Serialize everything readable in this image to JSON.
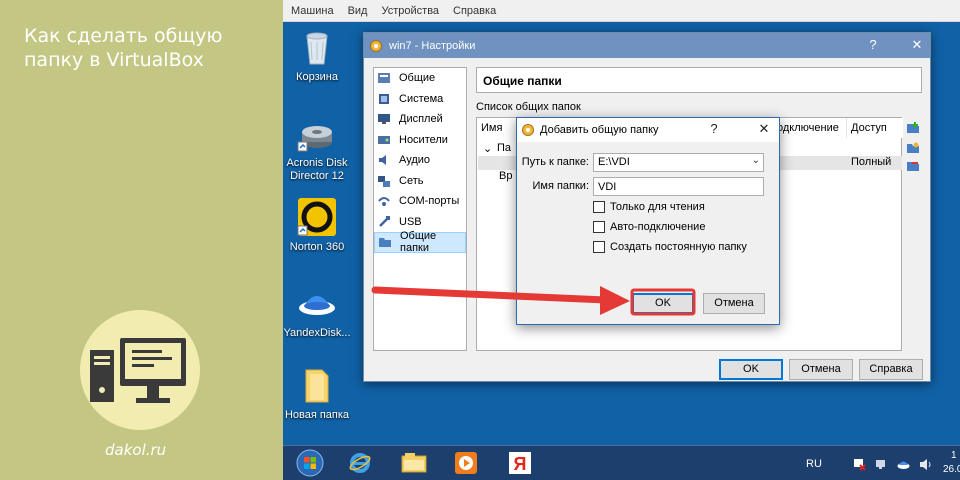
{
  "promo": {
    "title": "Как сделать общую папку в VirtualBox",
    "site": "dakol.ru"
  },
  "host_menu": [
    "Машина",
    "Вид",
    "Устройства",
    "Справка"
  ],
  "desktop_icons": [
    {
      "label": "Корзина",
      "icon": "recycle-bin-icon"
    },
    {
      "label": "Acronis Disk Director 12",
      "icon": "acronis-disk-icon"
    },
    {
      "label": "Norton 360",
      "icon": "norton-icon"
    },
    {
      "label": "YandexDisk...",
      "icon": "yandex-disk-icon"
    },
    {
      "label": "Новая папка",
      "icon": "folder-icon"
    }
  ],
  "settings": {
    "title": "win7 - Настройки",
    "help_btn": "?",
    "close_btn": "✕",
    "nav": [
      {
        "label": "Общие",
        "icon": "general-icon"
      },
      {
        "label": "Система",
        "icon": "system-icon"
      },
      {
        "label": "Дисплей",
        "icon": "display-icon"
      },
      {
        "label": "Носители",
        "icon": "storage-icon"
      },
      {
        "label": "Аудио",
        "icon": "audio-icon"
      },
      {
        "label": "Сеть",
        "icon": "network-icon"
      },
      {
        "label": "COM-порты",
        "icon": "com-ports-icon"
      },
      {
        "label": "USB",
        "icon": "usb-icon"
      },
      {
        "label": "Общие папки",
        "icon": "shared-folders-icon"
      }
    ],
    "active_nav": "Общие папки",
    "section_title": "Общие папки",
    "folders_label": "Список общих папок",
    "table": {
      "col_name": "Имя",
      "col_auto": "одключение",
      "col_access": "Доступ",
      "row_group_partial": "Па",
      "row_item_partial": "Вр",
      "row_access": "Полный"
    },
    "buttons": {
      "ok": "OK",
      "cancel": "Отмена",
      "help": "Справка"
    }
  },
  "dialog": {
    "title": "Добавить общую папку",
    "help_btn": "?",
    "close_btn": "✕",
    "path_label": "Путь к папке:",
    "path_value": "E:\\VDI",
    "name_label": "Имя папки:",
    "name_value": "VDI",
    "checkboxes": [
      {
        "label": "Только для чтения",
        "checked": false
      },
      {
        "label": "Авто-подключение",
        "checked": false
      },
      {
        "label": "Создать постоянную папку",
        "checked": false
      }
    ],
    "ok": "OK",
    "cancel": "Отмена"
  },
  "taskbar": {
    "lang": "RU",
    "time": "1",
    "date": "26.0",
    "items": [
      "start-orb-icon",
      "internet-explorer-icon",
      "explorer-icon",
      "media-player-icon",
      "yandex-browser-icon"
    ]
  },
  "colors": {
    "promo_bg": "#c4c783",
    "desktop_bg": "#1061a6",
    "titlebar": "#6f92c0",
    "arrow": "#e53935"
  }
}
